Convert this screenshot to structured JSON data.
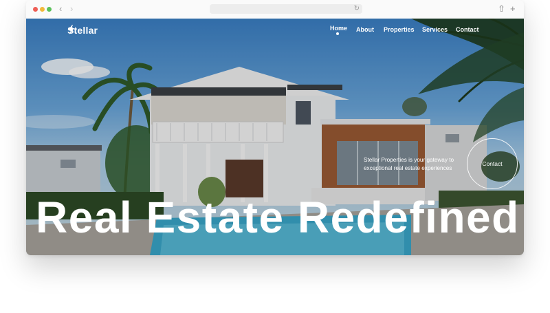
{
  "browser": {
    "back_icon": "chevron-left-icon",
    "forward_icon": "chevron-right-icon",
    "reload_icon": "reload-icon",
    "share_icon": "share-icon",
    "new_tab_icon": "plus-icon"
  },
  "site": {
    "brand": "Stellar",
    "brand_icon": "lightning-bolt-icon"
  },
  "nav": {
    "items": [
      {
        "label": "Home",
        "active": true
      },
      {
        "label": "About",
        "active": false
      },
      {
        "label": "Properties",
        "active": false
      },
      {
        "label": "Services",
        "active": false
      },
      {
        "label": "Contact",
        "active": false
      }
    ]
  },
  "hero": {
    "tagline": "Stellar Properties is your gateway to exceptional real estate experiences",
    "contact_button": "Contact",
    "headline": "Real Estate Redefined"
  },
  "colors": {
    "text": "#ffffff",
    "sky": "#3a7fc4"
  }
}
